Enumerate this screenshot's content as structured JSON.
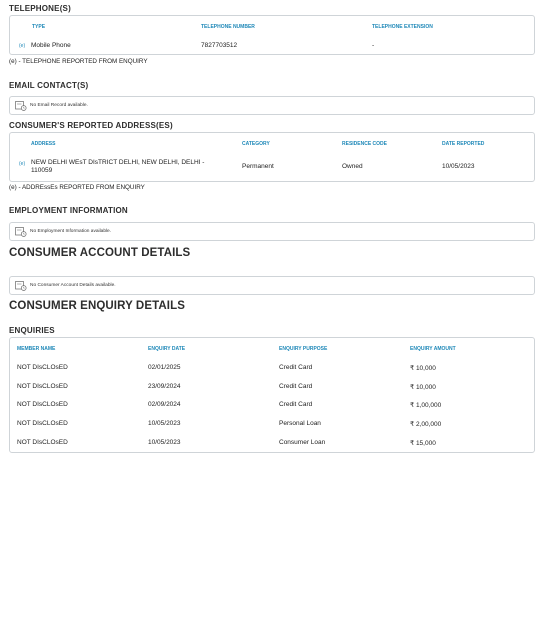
{
  "telephone": {
    "title": "TELEPHONE(S)",
    "headers": [
      "TYPE",
      "TELEPHONE NUMBER",
      "TELEPHONE EXTENSION"
    ],
    "rows": [
      {
        "tag": "(e)",
        "type": "Mobile Phone",
        "number": "7827703512",
        "extension": "-"
      }
    ],
    "note": "(e) - TELEPHONE REPORTED FROM ENQUIRY"
  },
  "email": {
    "title": "EMAIL CONTACT(S)",
    "empty_text": "No Email Record available."
  },
  "address": {
    "title": "CONSUMER'S REPORTED ADDRESS(ES)",
    "headers": [
      "ADDRESS",
      "CATEGORY",
      "RESIDENCE CODE",
      "DATE REPORTED"
    ],
    "rows": [
      {
        "tag": "(e)",
        "address_line1": "NEW DELHI WEsT DIsTRICT DELHI, NEW DELHI, DELHI -",
        "address_line2": "110059",
        "category": "Permanent",
        "residence": "Owned",
        "date": "10/05/2023"
      }
    ],
    "note": "(e) - ADDREssEs REPORTED FROM ENQUIRY"
  },
  "employment": {
    "title": "EMPLOYMENT INFORMATION",
    "empty_text": "No Employment Information available."
  },
  "accounts": {
    "title": "CONSUMER ACCOUNT DETAILS",
    "empty_text": "No Consumer Account Details available."
  },
  "enquiry_details": {
    "title": "CONSUMER ENQUIRY DETAILS"
  },
  "enquiries": {
    "title": "ENQUIRIES",
    "headers": [
      "MEMBER NAME",
      "ENQUIRY DATE",
      "ENQUIRY PURPOSE",
      "ENQUIRY AMOUNT"
    ],
    "rows": [
      {
        "member": "NOT DIsCLOsED",
        "date": "02/01/2025",
        "purpose": "Credit Card",
        "amount": "₹ 10,000"
      },
      {
        "member": "NOT DIsCLOsED",
        "date": "23/09/2024",
        "purpose": "Credit Card",
        "amount": "₹ 10,000"
      },
      {
        "member": "NOT DIsCLOsED",
        "date": "02/09/2024",
        "purpose": "Credit Card",
        "amount": "₹ 1,00,000"
      },
      {
        "member": "NOT DIsCLOsED",
        "date": "10/05/2023",
        "purpose": "Personal Loan",
        "amount": "₹ 2,00,000"
      },
      {
        "member": "NOT DIsCLOsED",
        "date": "10/05/2023",
        "purpose": "Consumer Loan",
        "amount": "₹ 15,000"
      }
    ]
  },
  "icons": {
    "empty_record": "document-clock-icon"
  },
  "colors": {
    "header_blue": "#1e88b8",
    "border": "#cfd4d8",
    "title": "#2d2d2d"
  }
}
